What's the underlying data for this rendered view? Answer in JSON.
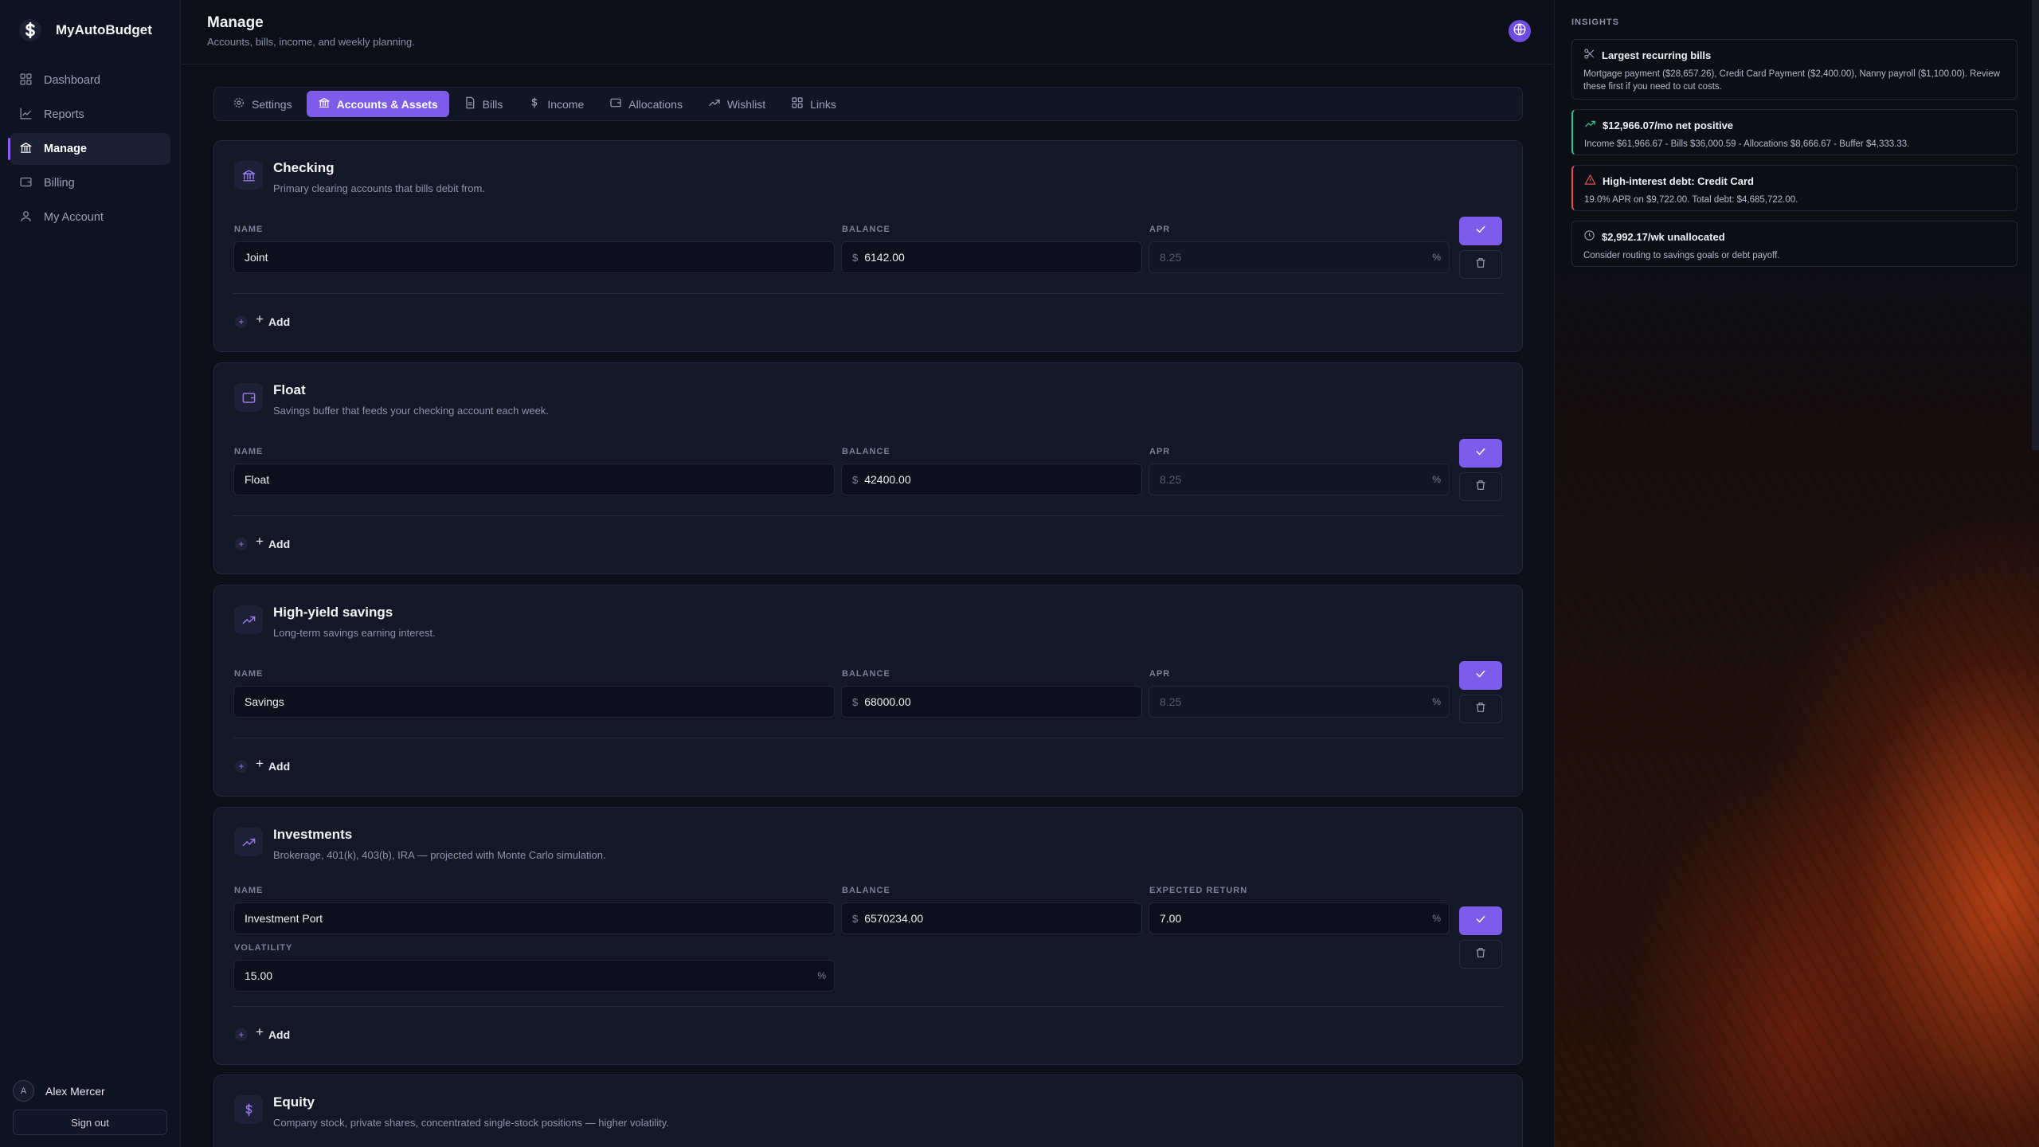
{
  "app": {
    "name": "MyAutoBudget"
  },
  "sidebar": {
    "items": [
      {
        "label": "Dashboard",
        "icon": "dashboard-icon"
      },
      {
        "label": "Reports",
        "icon": "chart-line-icon"
      },
      {
        "label": "Manage",
        "icon": "bank-icon",
        "active": true
      },
      {
        "label": "Billing",
        "icon": "wallet-icon"
      },
      {
        "label": "My Account",
        "icon": "user-icon"
      }
    ],
    "user": {
      "initial": "A",
      "name": "Alex Mercer"
    },
    "sign_out": "Sign out"
  },
  "header": {
    "title": "Manage",
    "subtitle": "Accounts, bills, income, and weekly planning."
  },
  "tabs": [
    {
      "label": "Settings",
      "icon": "gear-icon"
    },
    {
      "label": "Accounts & Assets",
      "icon": "bank-icon",
      "active": true
    },
    {
      "label": "Bills",
      "icon": "document-icon"
    },
    {
      "label": "Income",
      "icon": "dollar-icon"
    },
    {
      "label": "Allocations",
      "icon": "wallet-icon"
    },
    {
      "label": "Wishlist",
      "icon": "trend-up-icon"
    },
    {
      "label": "Links",
      "icon": "grid-icon"
    }
  ],
  "labels": {
    "name": "NAME",
    "balance": "BALANCE",
    "apr": "APR",
    "expected_return": "EXPECTED RETURN",
    "volatility": "VOLATILITY",
    "currency": "$",
    "percent": "%",
    "add": "Add",
    "add_plus": "+"
  },
  "cards": {
    "checking": {
      "title": "Checking",
      "description": "Primary clearing accounts that bills debit from.",
      "name": "Joint",
      "balance": "6142.00",
      "apr_placeholder": "8.25"
    },
    "float": {
      "title": "Float",
      "description": "Savings buffer that feeds your checking account each week.",
      "name": "Float",
      "balance": "42400.00",
      "apr_placeholder": "8.25"
    },
    "savings": {
      "title": "High-yield savings",
      "description": "Long-term savings earning interest.",
      "name": "Savings",
      "balance": "68000.00",
      "apr_placeholder": "8.25"
    },
    "investments": {
      "title": "Investments",
      "description": "Brokerage, 401(k), 403(b), IRA — projected with Monte Carlo simulation.",
      "name": "Investment Port",
      "balance": "6570234.00",
      "expected_return": "7.00",
      "volatility": "15.00"
    },
    "equity": {
      "title": "Equity",
      "description": "Company stock, private shares, concentrated single-stock positions — higher volatility."
    }
  },
  "insights": {
    "label": "INSIGHTS",
    "items": [
      {
        "title": "Largest recurring bills",
        "body": "Mortgage payment ($28,657.26), Credit Card Payment ($2,400.00), Nanny payroll ($1,100.00). Review these first if you need to cut costs.",
        "icon": "scissors-icon",
        "tone": "neutral"
      },
      {
        "title": "$12,966.07/mo net positive",
        "body": "Income $61,966.67 - Bills $36,000.59 - Allocations $8,666.67 - Buffer $4,333.33.",
        "icon": "trend-up-icon",
        "tone": "good"
      },
      {
        "title": "High-interest debt: Credit Card",
        "body": "19.0% APR on $9,722.00. Total debt: $4,685,722.00.",
        "icon": "warning-icon",
        "tone": "bad"
      },
      {
        "title": "$2,992.17/wk unallocated",
        "body": "Consider routing to savings goals or debt payoff.",
        "icon": "clock-icon",
        "tone": "neutral"
      }
    ]
  },
  "colors": {
    "accent": "#7c5ce8",
    "background": "#0c0e18",
    "card": "#141726",
    "good": "#2fc48d",
    "bad": "#e0534f"
  }
}
